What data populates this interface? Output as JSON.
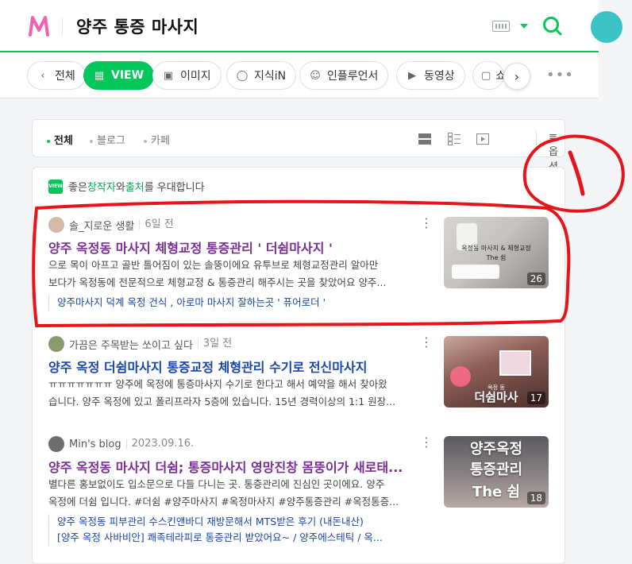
{
  "header": {
    "query": "양주 통증 마사지"
  },
  "tabs": [
    {
      "label": "전체",
      "icon": "chevron-left-icon"
    },
    {
      "label": "VIEW",
      "icon": "document-icon"
    },
    {
      "label": "이미지",
      "icon": "image-icon"
    },
    {
      "label": "지식iN",
      "icon": "q-icon"
    },
    {
      "label": "인플루언서",
      "icon": "person-icon"
    },
    {
      "label": "동영상",
      "icon": "play-icon"
    },
    {
      "label": "쇼",
      "icon": "bag-icon"
    }
  ],
  "filters": {
    "items": [
      "전체",
      "블로그",
      "카페"
    ],
    "option_label": "옵션"
  },
  "notice": {
    "pre": "좋은 ",
    "creator": "창작자",
    "mid": "와 ",
    "source": "출처",
    "post": "를 우대합니다",
    "badge": "VIEW"
  },
  "results": [
    {
      "author": "솔_지로운 생활",
      "date": "6일 전",
      "title": "양주 옥정동 마사지 체형교정 통증관리 ' 더쉼마사지 '",
      "desc_1": "으로 목이 아프고 골반 틀어짐이 있는 솔뚱이에요 유투브로 체형교정관리 알아만",
      "desc_2": "보다가 옥정동에 전문적으로 체형교정 & 통증관리 해주시는 곳을 찾았어요 양주...",
      "sub_1": "양주마사지 덕계 옥정 건식 , 아로마 마사지 잘하는곳 ' 퓨어로더 '",
      "thumb_count": "26",
      "thumb_caption_1": "옥정동 마사지 & 체형교정",
      "thumb_caption_2": "The 쉼"
    },
    {
      "author": "가끔은 주목받는 쏘이고 싶다",
      "date": "3일 전",
      "title": "양주 옥정 더쉼마사지 통증교정 체형관리 수기로 전신마사지",
      "desc_1": "ㅠㅠㅠㅠㅠㅠㅠ 양주에 옥정에 통증마사지 수기로 한다고 해서 예약을 해서 찾아왔",
      "desc_2": "습니다. 양주 옥정에 있고 폴리프라자 5층에 있습니다. 15년 경력이상의 1:1 원장...",
      "thumb_count": "17",
      "thumb_caption_1": "더쉼마사",
      "thumb_caption_2": "옥정 동"
    },
    {
      "author": "Min's blog",
      "date": "2023.09.16.",
      "title": "양주 옥정동 마사지 더쉼; 통증마사지 영망진창 몸뚱이가 새로태...",
      "desc_1": "별다른 홍보없이도 입소문으로 다들 다니는 곳. 통증관리에 진심인 곳이에요. 양주",
      "desc_2": "옥정에 더쉼 입니다. #더쉼 #양주마사지 #옥정마사지 #양주통증관리 #옥정통증...",
      "sub_1": "양주 옥정동 피부관리 수스킨앤바디 재방문해서 MTS받은 후기 (내돈내산)",
      "sub_2": "[양주 옥정 사바비안] 쾌족테라피로 통증관리 받았어요~ / 양주에스테틱 / 옥...",
      "thumb_count": "18",
      "thumb_caption_1": "양주옥정",
      "thumb_caption_2": "통증관리",
      "thumb_caption_3": "The 쉼"
    }
  ],
  "colors": {
    "accent": "#03c75a",
    "title_purple": "#7b2d97",
    "title_blue": "#1846a8",
    "annotation": "#e8141b"
  }
}
